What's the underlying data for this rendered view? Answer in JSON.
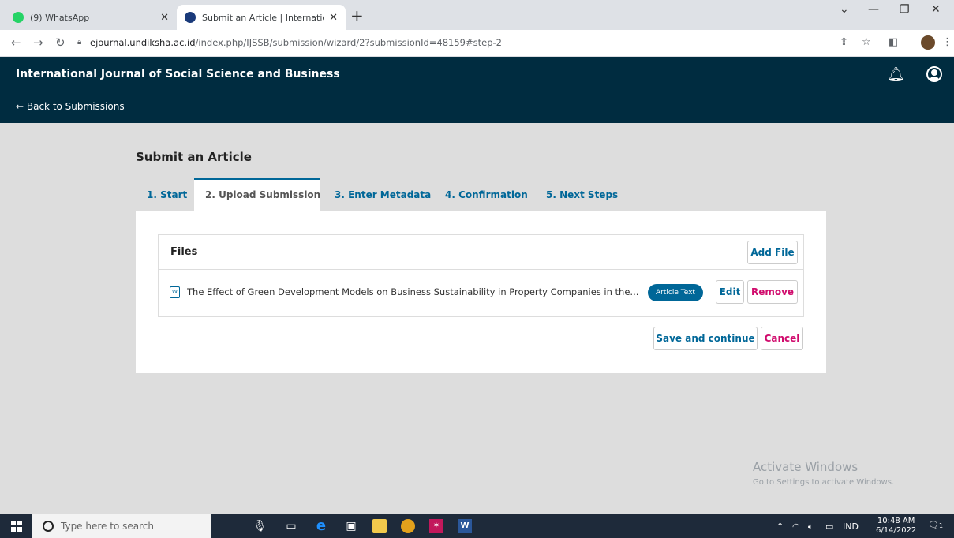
{
  "browser": {
    "tabs": [
      {
        "title": "(9) WhatsApp",
        "active": false,
        "favicon_color": "#25d366"
      },
      {
        "title": "Submit an Article | International Jo",
        "active": true,
        "favicon_color": "#1a3a7a"
      }
    ],
    "url_host": "ejournal.undiksha.ac.id",
    "url_path": "/index.php/IJSSB/submission/wizard/2?submissionId=48159#step-2"
  },
  "header": {
    "journal_title": "International Journal of Social Science and Business",
    "back_link": "← Back to Submissions"
  },
  "page": {
    "title": "Submit an Article",
    "steps": [
      {
        "label": "1. Start"
      },
      {
        "label": "2. Upload Submission",
        "current": true
      },
      {
        "label": "3. Enter Metadata"
      },
      {
        "label": "4. Confirmation"
      },
      {
        "label": "5. Next Steps"
      }
    ],
    "files": {
      "heading": "Files",
      "add_label": "Add File",
      "items": [
        {
          "name": "The Effect of Green Development Models on Business Sustainability in Property Companies in the...",
          "genre": "Article Text",
          "edit_label": "Edit",
          "remove_label": "Remove"
        }
      ]
    },
    "actions": {
      "save_label": "Save and continue",
      "cancel_label": "Cancel"
    }
  },
  "watermark": {
    "title": "Activate Windows",
    "subtitle": "Go to Settings to activate Windows."
  },
  "taskbar": {
    "search_placeholder": "Type here to search",
    "language": "IND",
    "time": "10:48 AM",
    "date": "6/14/2022",
    "notification_count": "1"
  },
  "colors": {
    "header_bg": "#002c40",
    "link": "#006798",
    "danger": "#d00a6c"
  }
}
